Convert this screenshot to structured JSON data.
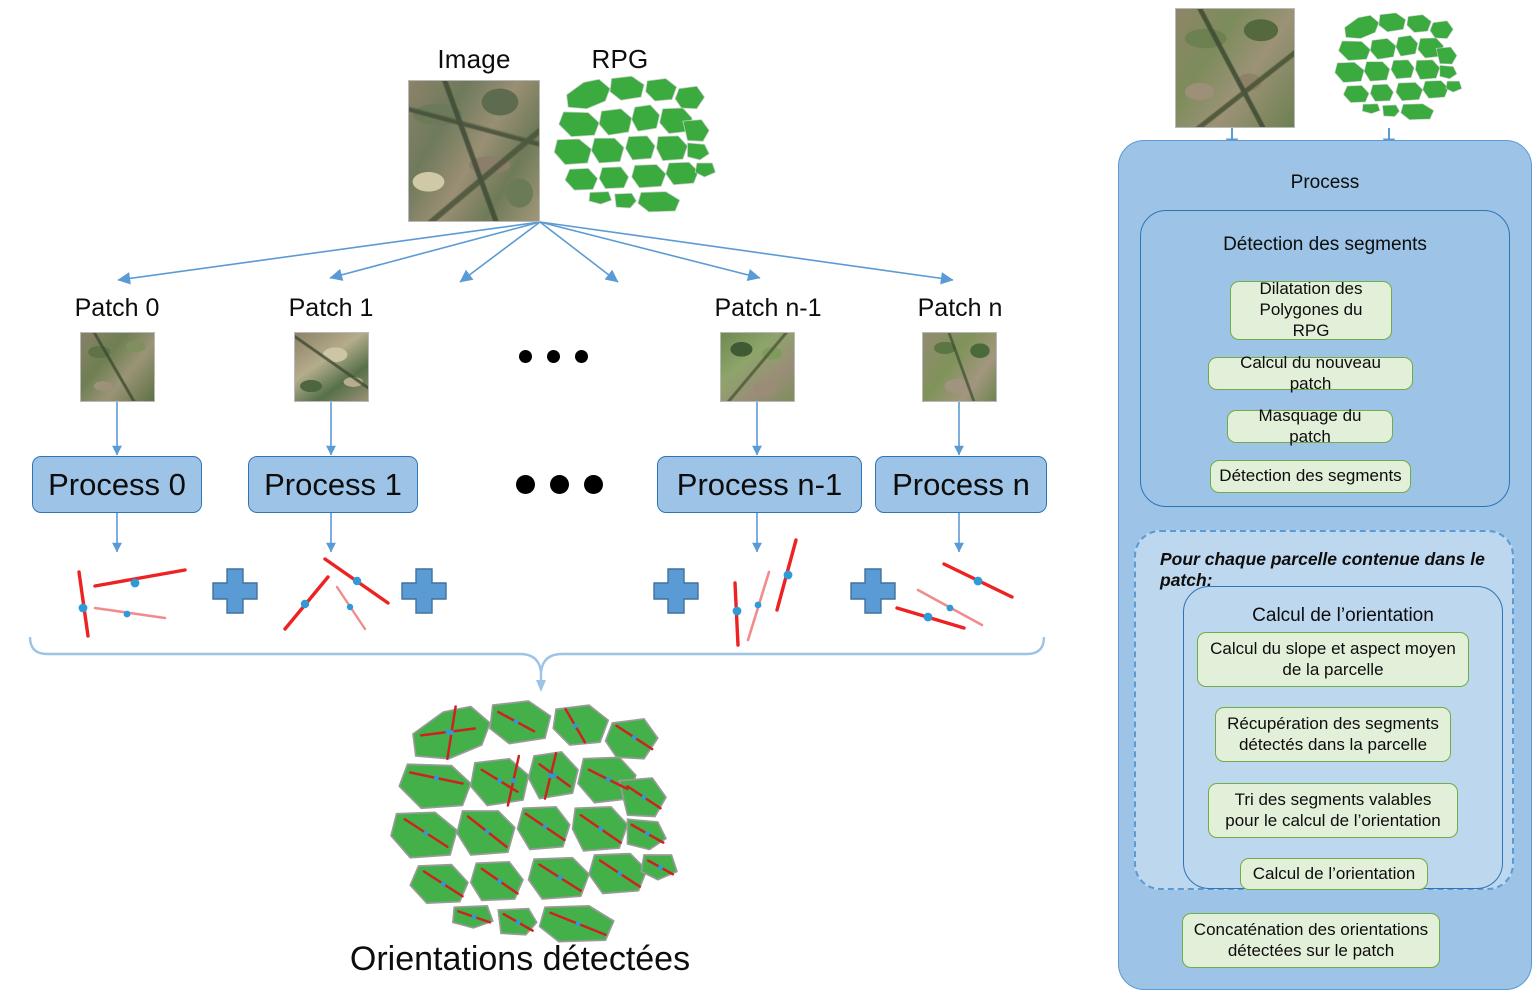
{
  "diagram": {
    "title_bottom": "Orientations détectées",
    "inputs": [
      {
        "label": "Image",
        "kind": "satellite-photo"
      },
      {
        "label": "RPG",
        "kind": "green-parcel-map"
      }
    ],
    "patches": [
      {
        "label": "Patch 0"
      },
      {
        "label": "Patch 1"
      },
      {
        "label": "Patch n-1"
      },
      {
        "label": "Patch n"
      }
    ],
    "processes": [
      {
        "label": "Process 0"
      },
      {
        "label": "Process 1"
      },
      {
        "label": "Process n-1"
      },
      {
        "label": "Process n"
      }
    ],
    "operators": [
      {
        "symbol": "+"
      },
      {
        "symbol": "+"
      },
      {
        "symbol": "+"
      },
      {
        "symbol": "+"
      }
    ],
    "ellipsis": "• • •"
  },
  "process_panel": {
    "title": "Process",
    "segment_detection": {
      "title": "Détection des segments",
      "steps": [
        "Dilatation des\nPolygones du RPG",
        "Calcul du nouveau patch",
        "Masquage du patch",
        "Détection des segments"
      ]
    },
    "loop": {
      "title": "Pour chaque parcelle contenue dans le patch:",
      "orientation": {
        "title": "Calcul de l’orientation",
        "steps": [
          "Calcul du slope et aspect moyen\nde la parcelle",
          "Récupération des segments\ndétectés dans la parcelle",
          "Tri des segments valables\npour le calcul de l’orientation",
          "Calcul de l’orientation"
        ]
      }
    },
    "final_step": "Concaténation des orientations\ndétectées sur le patch"
  },
  "colors": {
    "process_fill": "#9dc3e6",
    "process_stroke": "#2e75b6",
    "step_fill": "#e2efd9",
    "step_stroke": "#70ad47",
    "arrow": "#5b9bd5",
    "segment_red": "#ee2222",
    "segment_point": "#2e9bd6",
    "parcel_green": "#44b04a",
    "inner_panel_fill": "#bdd7ee"
  }
}
